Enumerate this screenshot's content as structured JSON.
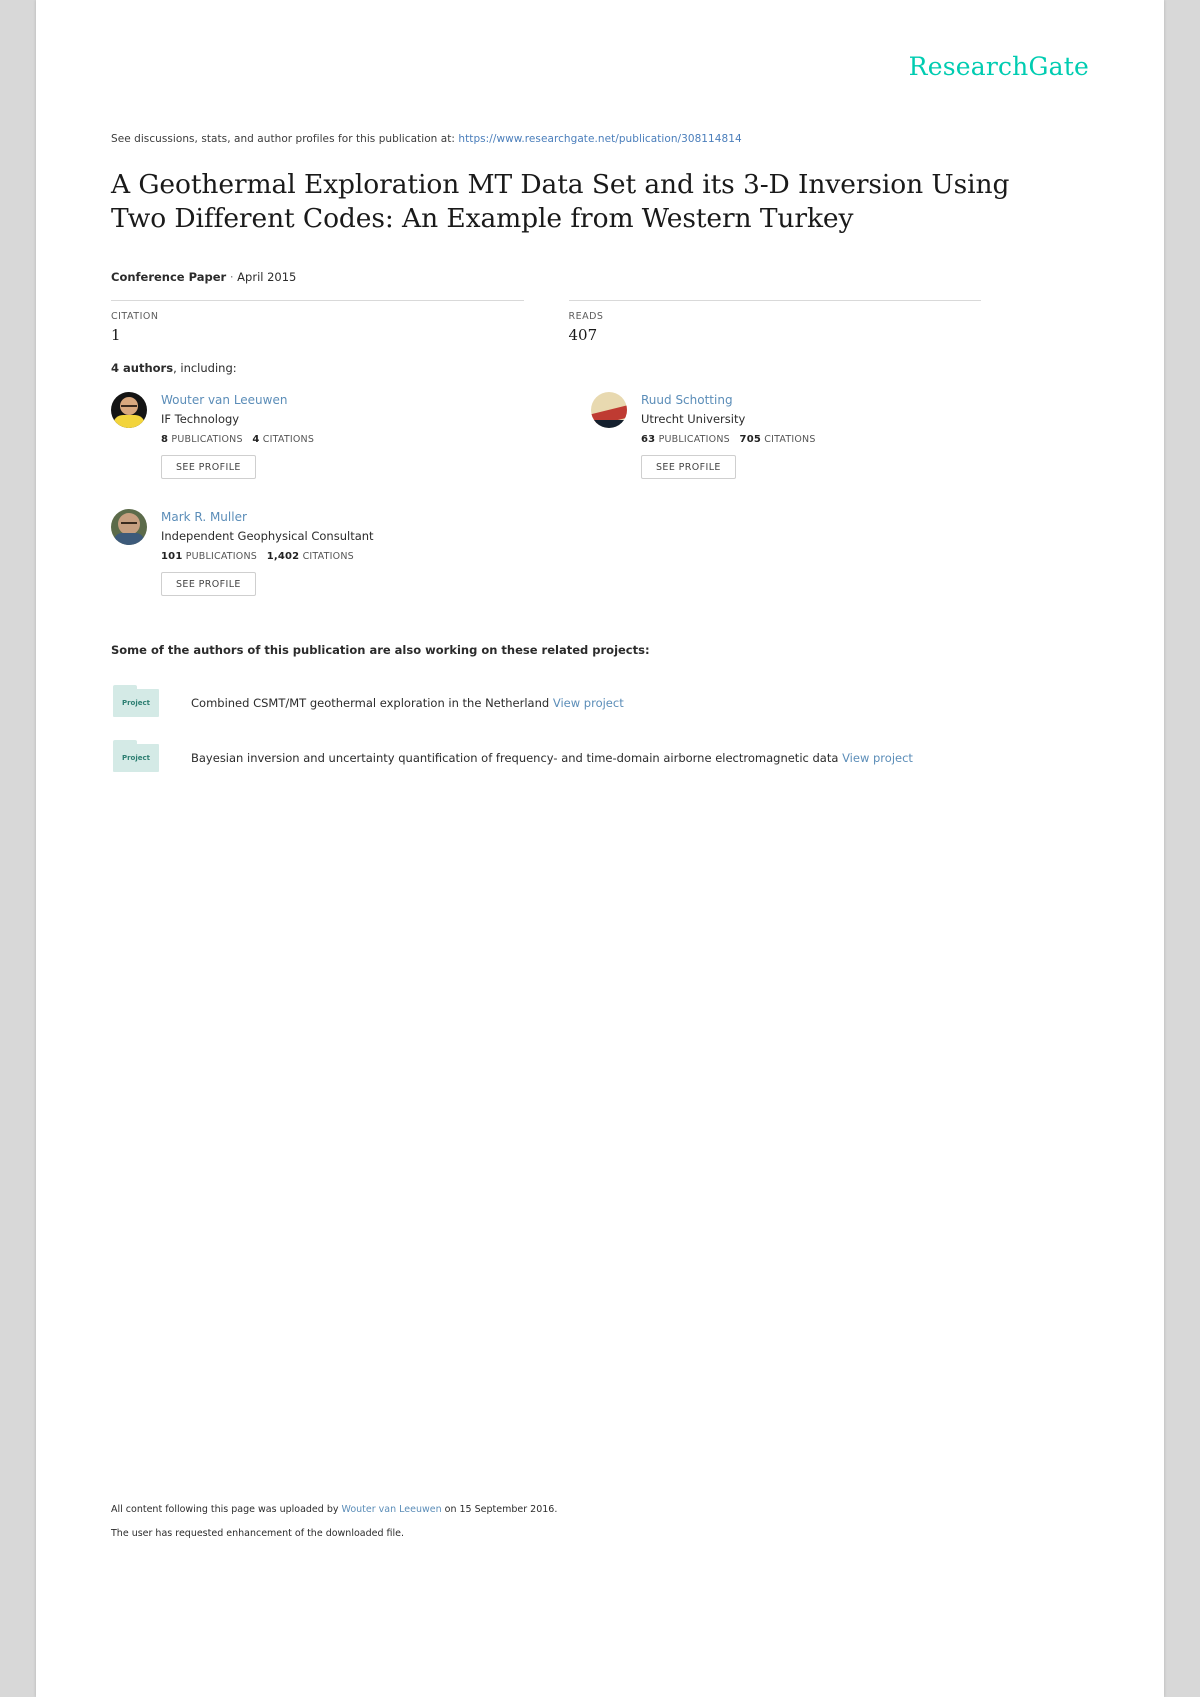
{
  "brand": "ResearchGate",
  "discussion": {
    "prefix": "See discussions, stats, and author profiles for this publication at:",
    "url": "https://www.researchgate.net/publication/308114814"
  },
  "title": "A Geothermal Exploration MT Data Set and its 3-D Inversion Using Two Different Codes: An Example from Western Turkey",
  "meta": {
    "type": "Conference Paper",
    "separator": "·",
    "date": "April 2015"
  },
  "stats": [
    {
      "label": "CITATION",
      "value": "1"
    },
    {
      "label": "READS",
      "value": "407"
    }
  ],
  "authors_head": {
    "count": "4 authors",
    "rest": ", including:"
  },
  "authors": [
    {
      "name": "Wouter van Leeuwen",
      "affiliation": "IF Technology",
      "publications_count": "8",
      "publications_label": "PUBLICATIONS",
      "citations_count": "4",
      "citations_label": "CITATIONS",
      "button": "SEE PROFILE",
      "avatar": "avatar-wouter-van-leeuwen"
    },
    {
      "name": "Ruud Schotting",
      "affiliation": "Utrecht University",
      "publications_count": "63",
      "publications_label": "PUBLICATIONS",
      "citations_count": "705",
      "citations_label": "CITATIONS",
      "button": "SEE PROFILE",
      "avatar": "avatar-ruud-schotting"
    },
    {
      "name": "Mark R. Muller",
      "affiliation": "Independent Geophysical Consultant",
      "publications_count": "101",
      "publications_label": "PUBLICATIONS",
      "citations_count": "1,402",
      "citations_label": "CITATIONS",
      "button": "SEE PROFILE",
      "avatar": "avatar-mark-r-muller"
    }
  ],
  "projects_head": "Some of the authors of this publication are also working on these related projects:",
  "projects": [
    {
      "icon_label": "Project",
      "text": "Combined CSMT/MT geothermal exploration in the Netherland",
      "link": "View project"
    },
    {
      "icon_label": "Project",
      "text": "Bayesian inversion and uncertainty quantification of frequency- and time-domain airborne electromagnetic data",
      "link": "View project"
    }
  ],
  "footer": {
    "line1_prefix": "All content following this page was uploaded by ",
    "line1_link": "Wouter van Leeuwen",
    "line1_suffix": " on 15 September 2016.",
    "line2": "The user has requested enhancement of the downloaded file."
  }
}
